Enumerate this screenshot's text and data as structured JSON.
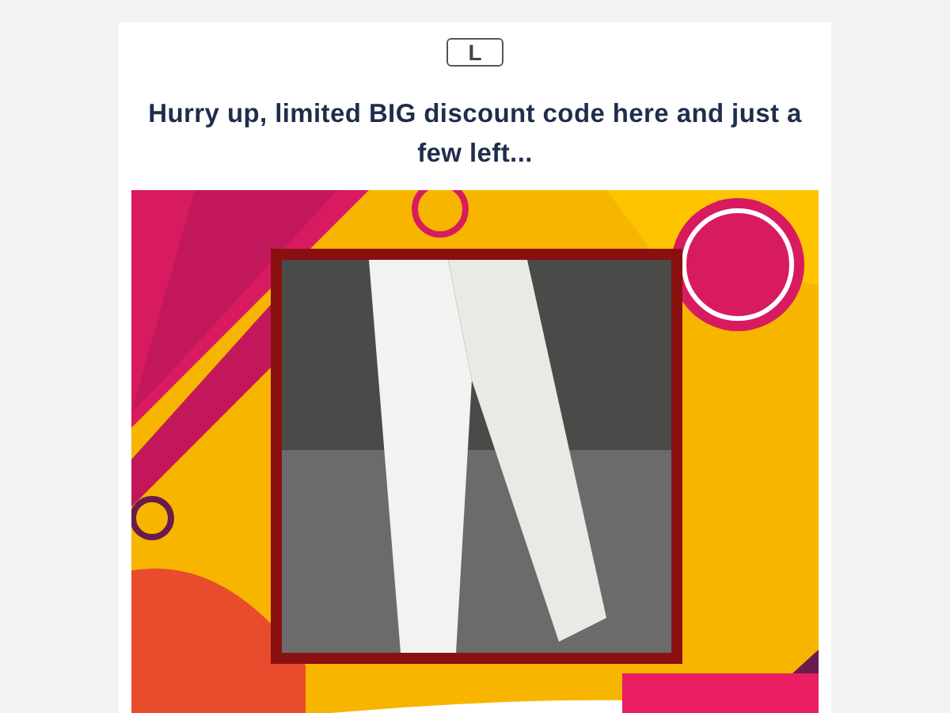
{
  "logo": {
    "letter": "L"
  },
  "headline": "Hurry up, limited BIG discount code here and just a few left..."
}
